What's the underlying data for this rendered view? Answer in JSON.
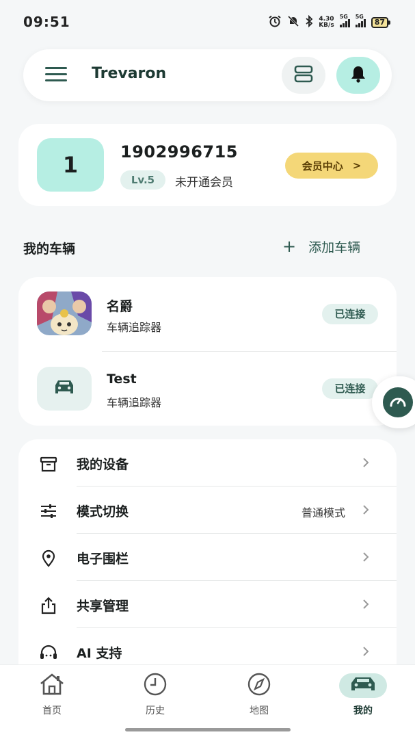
{
  "status_bar": {
    "time": "09:51",
    "net_speed_value": "4.30",
    "net_speed_unit": "KB/s",
    "sim1_label": "5G",
    "sim2_label": "5G",
    "battery": "87"
  },
  "header": {
    "title": "Trevaron",
    "menu_icon": "hamburger-icon",
    "layout_icon": "layout-icon",
    "bell_icon": "bell-icon"
  },
  "profile": {
    "avatar_text": "1",
    "user_id": "1902996715",
    "level": "Lv.5",
    "member_status": "未开通会员",
    "vip_button": "会员中心",
    "vip_chevron": ">"
  },
  "vehicles_section": {
    "title": "我的车辆",
    "add_label": "添加车辆",
    "add_icon": "+"
  },
  "vehicles": [
    {
      "name": "名爵",
      "type": "车辆追踪器",
      "status": "已连接",
      "thumb": "cartoon-image"
    },
    {
      "name": "Test",
      "type": "车辆追踪器",
      "status": "已连接",
      "thumb": "car-icon"
    }
  ],
  "menu": [
    {
      "label": "我的设备",
      "value": "",
      "icon": "device-box-icon"
    },
    {
      "label": "模式切换",
      "value": "普通模式",
      "icon": "sliders-icon"
    },
    {
      "label": "电子围栏",
      "value": "",
      "icon": "location-pin-icon"
    },
    {
      "label": "共享管理",
      "value": "",
      "icon": "share-icon"
    },
    {
      "label": "AI 支持",
      "value": "",
      "icon": "headset-icon"
    }
  ],
  "bottom_nav": [
    {
      "label": "首页",
      "icon": "home-icon",
      "active": false
    },
    {
      "label": "历史",
      "icon": "clock-icon",
      "active": false
    },
    {
      "label": "地图",
      "icon": "compass-icon",
      "active": false
    },
    {
      "label": "我的",
      "icon": "car-icon",
      "active": true
    }
  ],
  "colors": {
    "accent": "#2e5a50",
    "mint": "#b6eee3",
    "gold": "#f4d778",
    "background": "#f5f7f8"
  }
}
